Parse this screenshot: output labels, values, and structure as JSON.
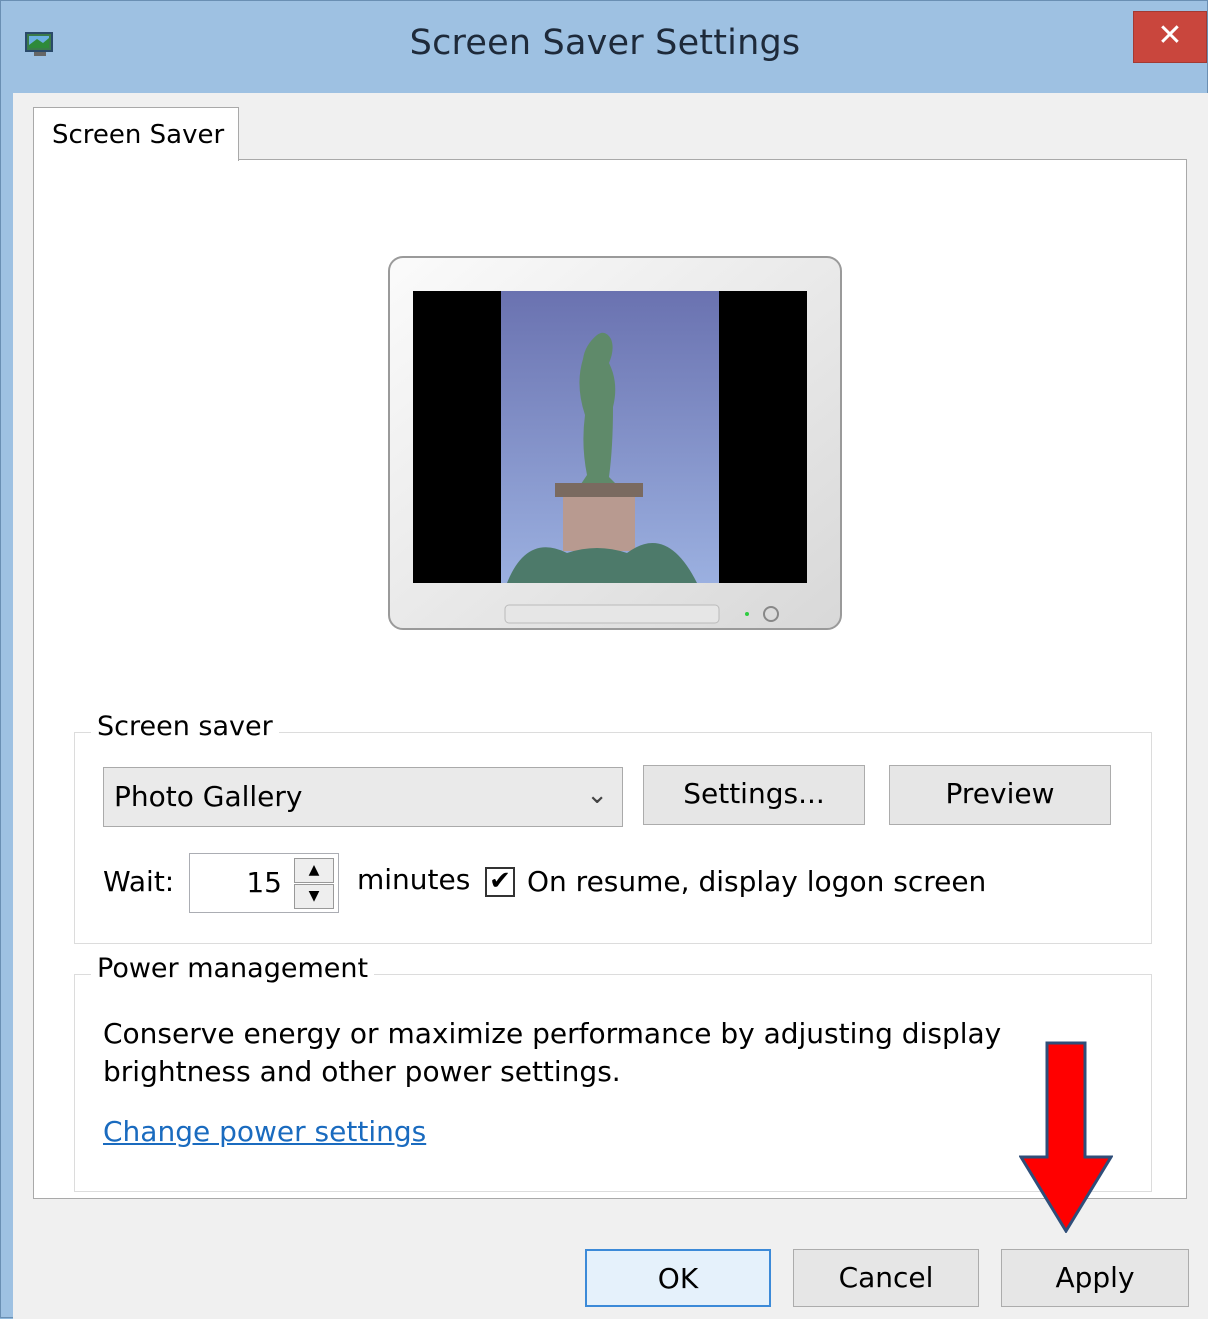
{
  "window": {
    "title": "Screen Saver Settings",
    "close_glyph": "✕"
  },
  "tabs": [
    {
      "label": "Screen Saver",
      "selected": true
    }
  ],
  "screen_saver_group": {
    "label": "Screen saver",
    "selected": "Photo Gallery",
    "settings_button": "Settings...",
    "preview_button": "Preview",
    "wait_label": "Wait:",
    "wait_value": "15",
    "minutes_label": "minutes",
    "resume_checkbox": {
      "label": "On resume, display logon screen",
      "checked": true,
      "glyph": "✔"
    }
  },
  "power_group": {
    "label": "Power management",
    "description": "Conserve energy or maximize performance by adjusting display brightness and other power settings.",
    "link": "Change power settings"
  },
  "buttons": {
    "ok": "OK",
    "cancel": "Cancel",
    "apply": "Apply"
  },
  "icons": {
    "chevron": "⌄",
    "spin_up": "▲",
    "spin_down": "▼"
  },
  "colors": {
    "title_bar": "#9ec1e2",
    "close": "#c9463d",
    "link": "#1a6bbf",
    "annotation_arrow": "#ff0000"
  }
}
